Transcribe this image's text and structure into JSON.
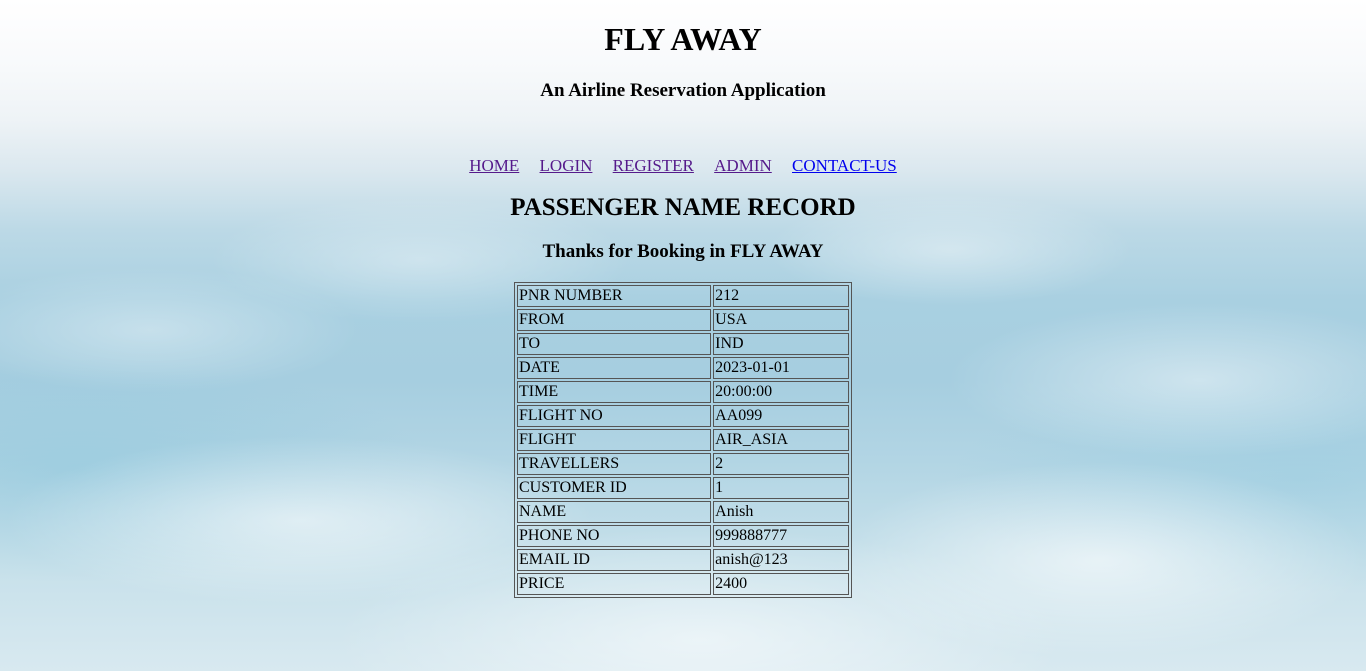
{
  "header": {
    "title": "FLY AWAY",
    "subtitle": "An Airline Reservation Application"
  },
  "nav": {
    "items": [
      {
        "label": "HOME"
      },
      {
        "label": "LOGIN"
      },
      {
        "label": "REGISTER"
      },
      {
        "label": "ADMIN"
      },
      {
        "label": "CONTACT-US"
      }
    ]
  },
  "main": {
    "heading": "PASSENGER NAME RECORD",
    "thanks": "Thanks for Booking in FLY AWAY",
    "record": [
      {
        "key": "PNR NUMBER",
        "value": "212"
      },
      {
        "key": "FROM",
        "value": "USA"
      },
      {
        "key": "TO",
        "value": "IND"
      },
      {
        "key": "DATE",
        "value": "2023-01-01"
      },
      {
        "key": "TIME",
        "value": "20:00:00"
      },
      {
        "key": "FLIGHT NO",
        "value": "AA099"
      },
      {
        "key": "FLIGHT",
        "value": "AIR_ASIA"
      },
      {
        "key": "TRAVELLERS",
        "value": "2"
      },
      {
        "key": "CUSTOMER ID",
        "value": "1"
      },
      {
        "key": "NAME",
        "value": "Anish"
      },
      {
        "key": "PHONE NO",
        "value": "999888777"
      },
      {
        "key": "EMAIL ID",
        "value": "anish@123"
      },
      {
        "key": "PRICE",
        "value": "2400"
      }
    ]
  },
  "colors": {
    "visited_link": "#551a8b",
    "unvisited_link": "#0000ee",
    "sky_blue": "#a6cee0"
  }
}
